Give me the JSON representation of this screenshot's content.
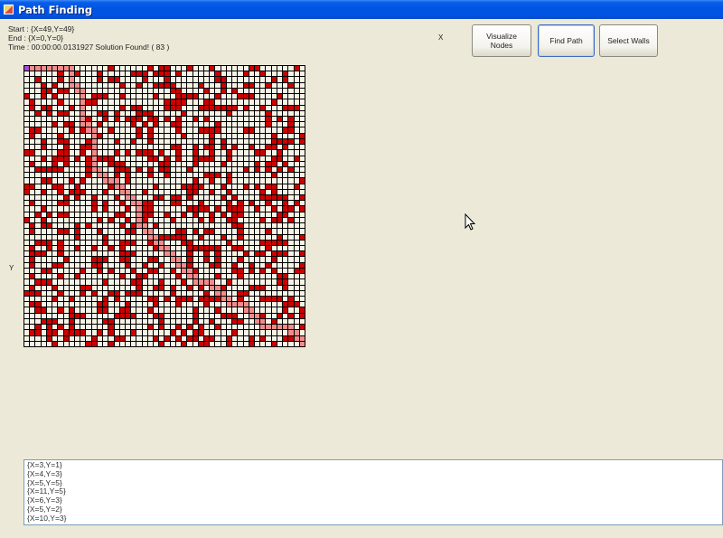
{
  "window": {
    "title": "Path Finding"
  },
  "info": {
    "start": "Start : {X=49,Y=49}",
    "end": "End : {X=0,Y=0}",
    "time": "Time : 00:00:00.0131927 Solution Found! ( 83 )"
  },
  "axis": {
    "x": "X",
    "y": "Y"
  },
  "buttons": {
    "visualize_line1": "Visualize",
    "visualize_line2": "Nodes",
    "find_path": "Find Path",
    "select_walls": "Select Walls"
  },
  "grid": {
    "cols": 50,
    "rows": 50,
    "wall_color": "#CC0000",
    "path_color": "#F28B8B",
    "empty_color": "#F5F2E6",
    "line_color": "#000000"
  },
  "output_lines": [
    "{X=3,Y=1}",
    "{X=4,Y=3}",
    "{X=5,Y=5}",
    "{X=11,Y=5}",
    "{X=6,Y=3}",
    "{X=5,Y=2}",
    "{X=10,Y=3}"
  ]
}
